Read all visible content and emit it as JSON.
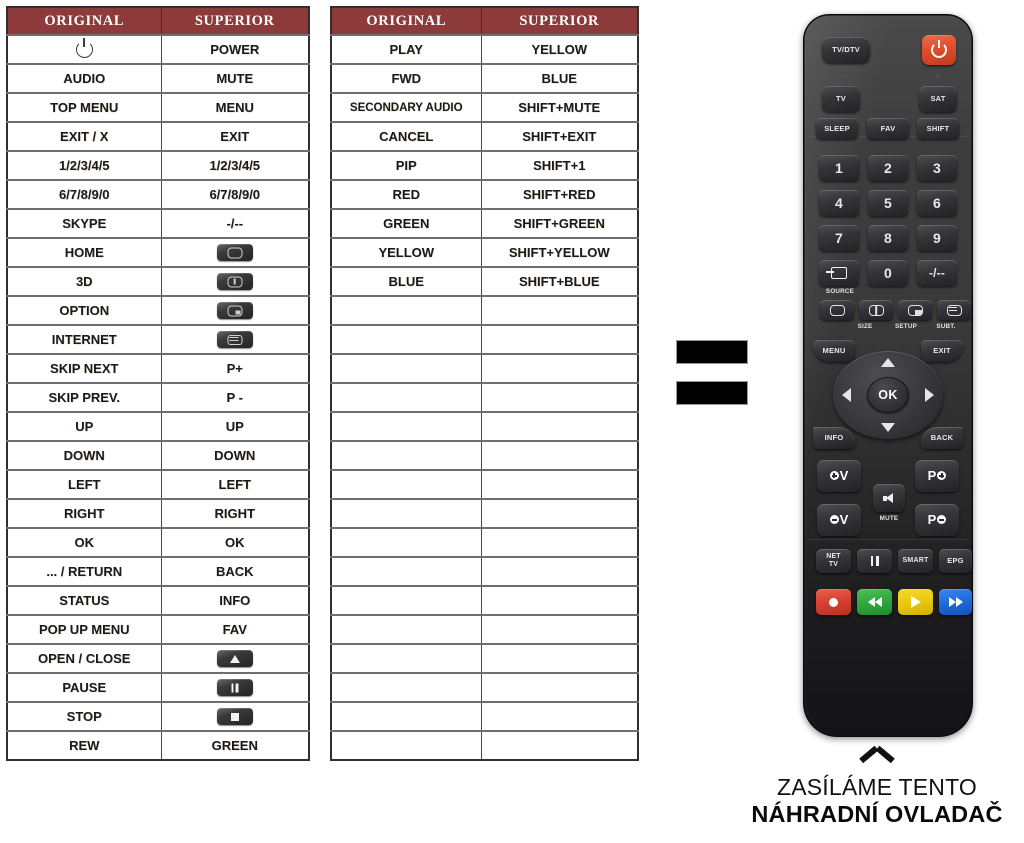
{
  "tables": [
    {
      "id": "table-left",
      "headers": [
        "ORIGINAL",
        "SUPERIOR"
      ],
      "rows": [
        {
          "original": "",
          "original_icon": "power-icon",
          "superior": "POWER"
        },
        {
          "original": "AUDIO",
          "superior": "MUTE"
        },
        {
          "original": "TOP MENU",
          "superior": "MENU"
        },
        {
          "original": "EXIT / X",
          "superior": "EXIT"
        },
        {
          "original": "1/2/3/4/5",
          "superior": "1/2/3/4/5"
        },
        {
          "original": "6/7/8/9/0",
          "superior": "6/7/8/9/0"
        },
        {
          "original": "SKYPE",
          "superior": "-/--"
        },
        {
          "original": "HOME",
          "superior": "",
          "superior_icon": "key-home-icon"
        },
        {
          "original": "3D",
          "superior": "",
          "superior_icon": "key-size-icon"
        },
        {
          "original": "OPTION",
          "superior": "",
          "superior_icon": "key-setup-icon"
        },
        {
          "original": "INTERNET",
          "superior": "",
          "superior_icon": "key-subtitle-icon"
        },
        {
          "original": "SKIP NEXT",
          "superior": "P+"
        },
        {
          "original": "SKIP PREV.",
          "superior": "P -"
        },
        {
          "original": "UP",
          "superior": "UP"
        },
        {
          "original": "DOWN",
          "superior": "DOWN"
        },
        {
          "original": "LEFT",
          "superior": "LEFT"
        },
        {
          "original": "RIGHT",
          "superior": "RIGHT"
        },
        {
          "original": "OK",
          "superior": "OK"
        },
        {
          "original": "... / RETURN",
          "superior": "BACK"
        },
        {
          "original": "STATUS",
          "superior": "INFO"
        },
        {
          "original": "POP UP MENU",
          "superior": "FAV"
        },
        {
          "original": "OPEN / CLOSE",
          "superior": "",
          "superior_icon": "key-eject-icon"
        },
        {
          "original": "PAUSE",
          "superior": "",
          "superior_icon": "key-pause-icon"
        },
        {
          "original": "STOP",
          "superior": "",
          "superior_icon": "key-stop-icon"
        },
        {
          "original": "REW",
          "superior": "GREEN"
        }
      ]
    },
    {
      "id": "table-right",
      "headers": [
        "ORIGINAL",
        "SUPERIOR"
      ],
      "rows": [
        {
          "original": "PLAY",
          "superior": "YELLOW"
        },
        {
          "original": "FWD",
          "superior": "BLUE"
        },
        {
          "original": "SECONDARY AUDIO",
          "superior": "SHIFT+MUTE"
        },
        {
          "original": "CANCEL",
          "superior": "SHIFT+EXIT"
        },
        {
          "original": "PIP",
          "superior": "SHIFT+1"
        },
        {
          "original": "RED",
          "superior": "SHIFT+RED"
        },
        {
          "original": "GREEN",
          "superior": "SHIFT+GREEN"
        },
        {
          "original": "YELLOW",
          "superior": "SHIFT+YELLOW"
        },
        {
          "original": "BLUE",
          "superior": "SHIFT+BLUE"
        },
        {
          "original": "",
          "superior": ""
        },
        {
          "original": "",
          "superior": ""
        },
        {
          "original": "",
          "superior": ""
        },
        {
          "original": "",
          "superior": ""
        },
        {
          "original": "",
          "superior": ""
        },
        {
          "original": "",
          "superior": ""
        },
        {
          "original": "",
          "superior": ""
        },
        {
          "original": "",
          "superior": ""
        },
        {
          "original": "",
          "superior": ""
        },
        {
          "original": "",
          "superior": ""
        },
        {
          "original": "",
          "superior": ""
        },
        {
          "original": "",
          "superior": ""
        },
        {
          "original": "",
          "superior": ""
        },
        {
          "original": "",
          "superior": ""
        },
        {
          "original": "",
          "superior": ""
        },
        {
          "original": "",
          "superior": ""
        }
      ]
    }
  ],
  "equals_sign": {
    "label": "="
  },
  "remote": {
    "buttons": {
      "tvdtv": "TV/DTV",
      "power": "",
      "tv": "TV",
      "sat": "SAT",
      "sleep": "SLEEP",
      "fav": "FAV",
      "shift": "SHIFT",
      "n1": "1",
      "n2": "2",
      "n3": "3",
      "n4": "4",
      "n5": "5",
      "n6": "6",
      "n7": "7",
      "n8": "8",
      "n9": "9",
      "source": "",
      "n0": "0",
      "dash": "-/--",
      "menu": "MENU",
      "exit": "EXIT",
      "ok": "OK",
      "info": "INFO",
      "back": "BACK",
      "volup": "V",
      "voldown": "V",
      "mute": "",
      "pplus": "P",
      "pminus": "P",
      "nettv": "NET\nTV",
      "pause": "",
      "smart": "SMART",
      "epg": "EPG",
      "rec": "",
      "rew": "",
      "play": "",
      "ffwd": ""
    },
    "labels": {
      "source": "SOURCE",
      "size": "SIZE",
      "setup": "SETUP",
      "subt": "SUBT.",
      "mute": "MUTE"
    }
  },
  "caption": {
    "line1": "ZASÍLÁME TENTO",
    "line2": "NÁHRADNÍ OVLADAČ"
  },
  "colors": {
    "header_bg": "#8c3a3a",
    "header_text": "#ffffff",
    "cell_text": "#1a1a1a",
    "power_button": "#e04e2e",
    "color_red": "#d73f2e",
    "color_green": "#2ea83c",
    "color_yellow": "#ebc812",
    "color_blue": "#1e6ada"
  }
}
